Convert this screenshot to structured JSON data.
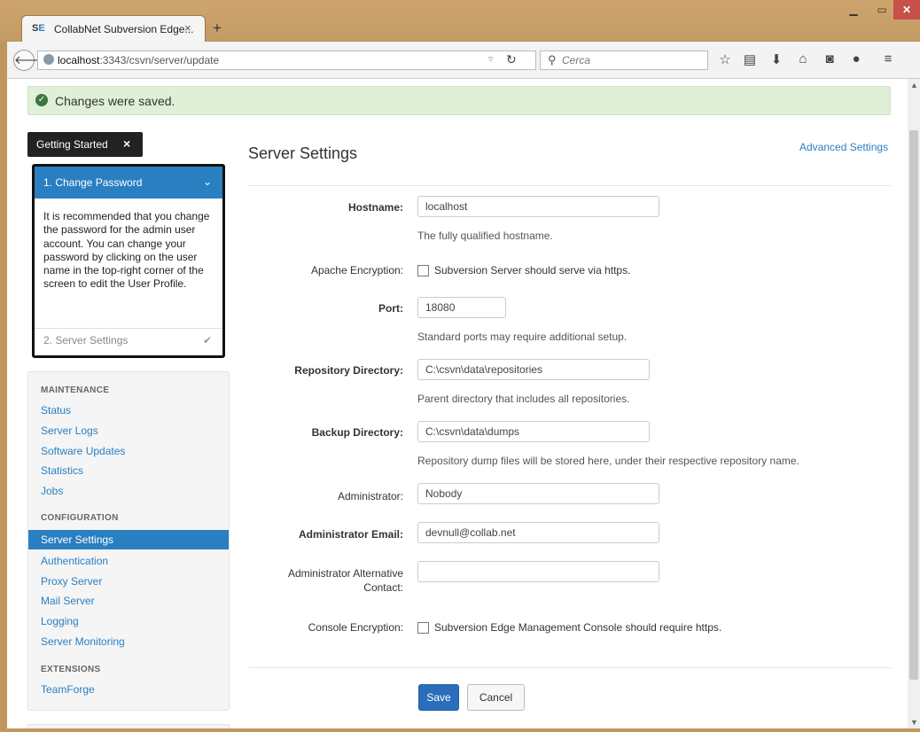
{
  "browser": {
    "tab_favicon_s": "S",
    "tab_favicon_e": "E",
    "tab_title": "CollabNet Subversion Edge...",
    "tab_close": "×",
    "new_tab": "+",
    "url_host": "localhost",
    "url_rest": ":3343/csvn/server/update",
    "search_placeholder": "Cerca"
  },
  "alert": {
    "message": "Changes were saved."
  },
  "getting_started": {
    "button_label": "Getting Started",
    "close": "×",
    "step1_label": "1. Change Password",
    "description": "It is recommended that you change the password for the admin user account. You can change your password by clicking on the user name in the top-right corner of the screen to edit the User Profile.",
    "step2_label": "2. Server Settings"
  },
  "sidebar": {
    "maintenance_heading": "MAINTENANCE",
    "maintenance_items": [
      "Status",
      "Server Logs",
      "Software Updates",
      "Statistics",
      "Jobs"
    ],
    "configuration_heading": "CONFIGURATION",
    "configuration_items": [
      "Server Settings",
      "Authentication",
      "Proxy Server",
      "Mail Server",
      "Logging",
      "Server Monitoring"
    ],
    "extensions_heading": "EXTENSIONS",
    "extensions_items": [
      "TeamForge"
    ],
    "active_item": "Server Settings"
  },
  "main": {
    "title": "Server Settings",
    "advanced_link": "Advanced Settings",
    "hostname_label": "Hostname:",
    "hostname_value": "localhost",
    "hostname_help": "The fully qualified hostname.",
    "apache_label": "Apache Encryption:",
    "apache_check_label": "Subversion Server should serve via https.",
    "port_label": "Port:",
    "port_value": "18080",
    "port_help": "Standard ports may require additional setup.",
    "repo_label": "Repository Directory:",
    "repo_value": "C:\\csvn\\data\\repositories",
    "repo_help": "Parent directory that includes all repositories.",
    "backup_label": "Backup Directory:",
    "backup_value": "C:\\csvn\\data\\dumps",
    "backup_help": "Repository dump files will be stored here, under their respective repository name.",
    "admin_label": "Administrator:",
    "admin_value": "Nobody",
    "email_label": "Administrator Email:",
    "email_value": "devnull@collab.net",
    "alt_contact_label_line1": "Administrator Alternative",
    "alt_contact_label_line2": "Contact:",
    "alt_contact_value": "",
    "console_label": "Console Encryption:",
    "console_check_label": "Subversion Edge Management Console should require https.",
    "save_label": "Save",
    "cancel_label": "Cancel"
  }
}
